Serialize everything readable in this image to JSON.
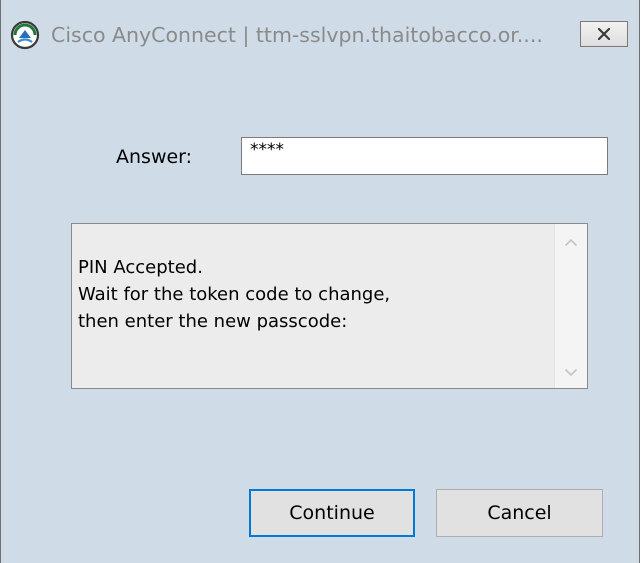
{
  "window": {
    "title": "Cisco AnyConnect | ttm-sslvpn.thaitobacco.or...."
  },
  "form": {
    "answer_label": "Answer:",
    "answer_value": "****"
  },
  "message": {
    "lines": [
      "PIN Accepted.",
      "Wait for the token code to change,",
      "then enter the new passcode:"
    ]
  },
  "buttons": {
    "continue_label": "Continue",
    "cancel_label": "Cancel"
  },
  "icons": {
    "app": "cisco-anyconnect-icon",
    "close": "close-icon",
    "scroll_up": "chevron-up-icon",
    "scroll_down": "chevron-down-icon"
  },
  "colors": {
    "dialog_background": "#cfdce8",
    "focus_border": "#0078d7"
  }
}
